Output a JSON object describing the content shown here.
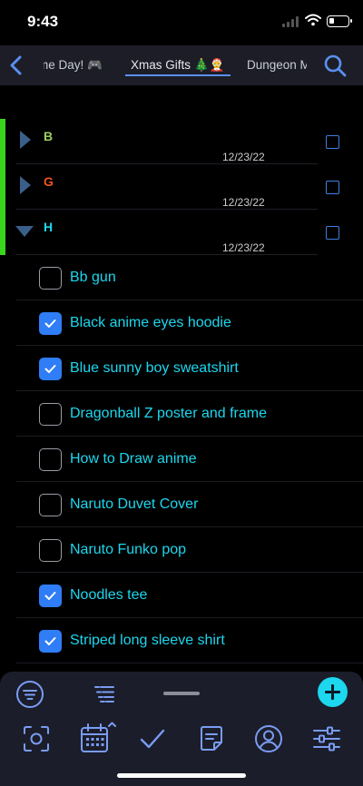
{
  "status_bar": {
    "time": "9:43"
  },
  "nav": {
    "tabs": [
      {
        "label": "me Day! 🎮"
      },
      {
        "label": "Xmas Gifts 🎄🤶"
      },
      {
        "label": "Dungeon Ma"
      }
    ],
    "active_tab_index": 1
  },
  "groups": [
    {
      "letter": "B",
      "date": "12/23/22",
      "color": "#9dcf5b",
      "expanded": false
    },
    {
      "letter": "G",
      "date": "12/23/22",
      "color": "#f0541e",
      "expanded": false
    },
    {
      "letter": "H",
      "date": "12/23/22",
      "color": "#1cd7ee",
      "expanded": true
    }
  ],
  "items": [
    {
      "label": "Bb gun",
      "checked": false
    },
    {
      "label": "Black anime eyes hoodie",
      "checked": true
    },
    {
      "label": "Blue sunny boy sweatshirt",
      "checked": true
    },
    {
      "label": "Dragonball Z poster and frame",
      "checked": false
    },
    {
      "label": "How to Draw anime",
      "checked": false
    },
    {
      "label": "Naruto Duvet Cover",
      "checked": false
    },
    {
      "label": "Naruto Funko pop",
      "checked": false
    },
    {
      "label": "Noodles tee",
      "checked": true
    },
    {
      "label": "Striped long sleeve shirt",
      "checked": true
    }
  ],
  "colors": {
    "accent": "#2f7df7",
    "item_text": "#1cd7ee",
    "group_bar": "#3ad51f",
    "icon_blue": "#7a9cf3"
  },
  "toolbar": {
    "icons": [
      "focus-icon",
      "calendar-icon",
      "checkmark-icon",
      "notes-icon",
      "profile-icon",
      "settings-sliders-icon"
    ]
  }
}
